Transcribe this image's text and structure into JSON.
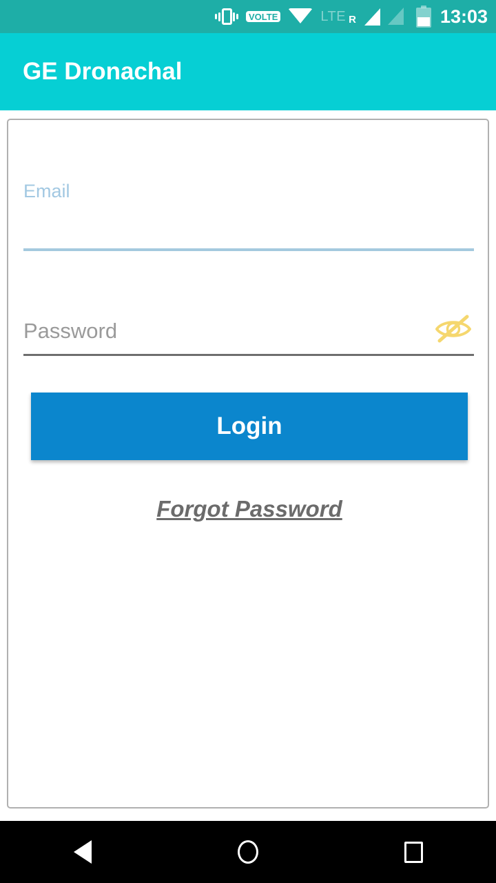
{
  "status_bar": {
    "icons": [
      {
        "name": "vibrate-icon",
        "label": "vibrate"
      },
      {
        "name": "volte-badge",
        "label": "VOLTE"
      },
      {
        "name": "wifi-icon",
        "label": "wifi"
      },
      {
        "name": "lte-icon",
        "label": "LTE"
      },
      {
        "name": "roaming-icon",
        "label": "R"
      },
      {
        "name": "signal-sim1-icon",
        "label": "signal-full"
      },
      {
        "name": "signal-sim2-icon",
        "label": "signal-empty"
      },
      {
        "name": "battery-icon",
        "label": "battery"
      }
    ],
    "volte_label": "VOLTE",
    "network_type": "LTE",
    "roaming_label": "R",
    "battery_level_percent": 50,
    "time": "13:03",
    "background_color": "#1eaea7"
  },
  "app_bar": {
    "title": "GE Dronachal",
    "background_color": "#06cfd4",
    "text_color": "#ffffff"
  },
  "login_form": {
    "email": {
      "label": "Email",
      "value": "",
      "placeholder": "",
      "label_color": "#a2c8e2",
      "underline_color": "#a4c9de"
    },
    "password": {
      "label": "Password",
      "value": "",
      "placeholder": "Password",
      "placeholder_color": "#9a9a9a",
      "underline_color": "#6e6e6e",
      "toggle_icon": "eye-slash-icon",
      "toggle_icon_color": "#f5d76e",
      "visible": false
    },
    "login_button": {
      "label": "Login",
      "background_color": "#0b86cd",
      "text_color": "#ffffff"
    },
    "forgot_password": {
      "label": "Forgot Password",
      "text_color": "#6b6b6b"
    },
    "card_border_color": "#b0b0b0"
  },
  "nav_bar": {
    "background_color": "#000000",
    "buttons": [
      {
        "name": "back-button",
        "icon": "triangle-left-icon"
      },
      {
        "name": "home-button",
        "icon": "circle-icon"
      },
      {
        "name": "recents-button",
        "icon": "square-icon"
      }
    ]
  }
}
